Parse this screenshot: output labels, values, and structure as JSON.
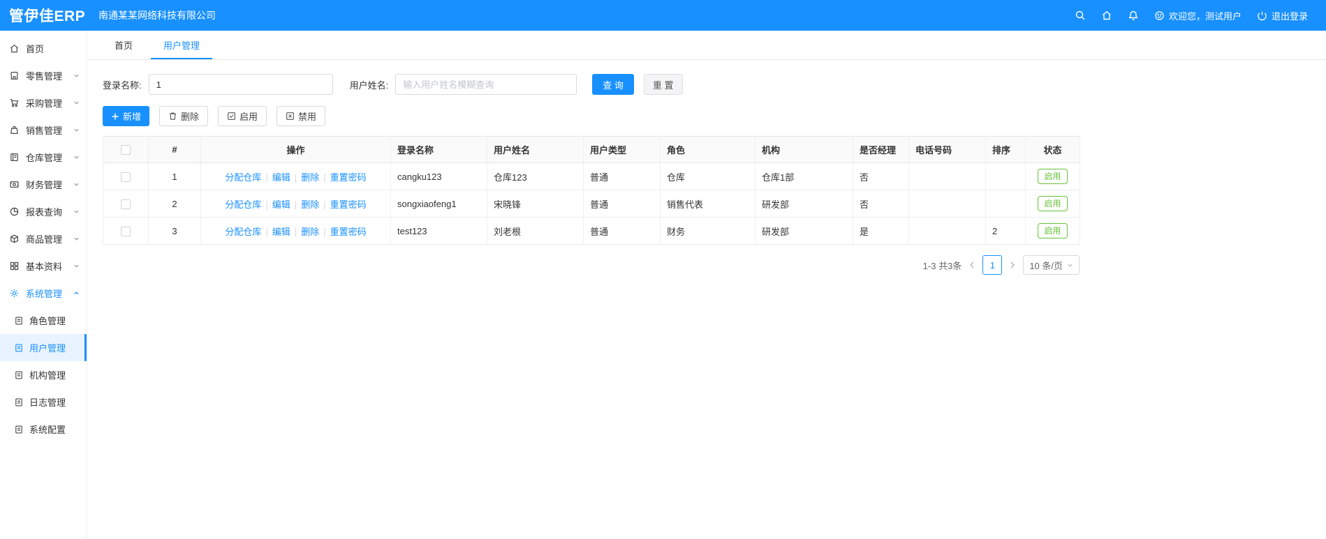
{
  "header": {
    "logo": "管伊佳ERP",
    "company": "南通某某网络科技有限公司",
    "welcome": "欢迎您，测试用户",
    "logout": "退出登录"
  },
  "sidebar": {
    "items": [
      {
        "label": "首页",
        "icon": "home-icon"
      },
      {
        "label": "零售管理",
        "icon": "retail-icon"
      },
      {
        "label": "采购管理",
        "icon": "purchase-icon"
      },
      {
        "label": "销售管理",
        "icon": "sales-icon"
      },
      {
        "label": "仓库管理",
        "icon": "warehouse-icon"
      },
      {
        "label": "财务管理",
        "icon": "finance-icon"
      },
      {
        "label": "报表查询",
        "icon": "report-icon"
      },
      {
        "label": "商品管理",
        "icon": "product-icon"
      },
      {
        "label": "基本资料",
        "icon": "basic-data-icon"
      },
      {
        "label": "系统管理",
        "icon": "gear-icon"
      }
    ],
    "system_children": [
      {
        "label": "角色管理"
      },
      {
        "label": "用户管理"
      },
      {
        "label": "机构管理"
      },
      {
        "label": "日志管理"
      },
      {
        "label": "系统配置"
      }
    ]
  },
  "tabs": [
    {
      "label": "首页"
    },
    {
      "label": "用户管理"
    }
  ],
  "search": {
    "login_label": "登录名称:",
    "login_value": "1",
    "username_label": "用户姓名:",
    "username_placeholder": "输入用户姓名模糊查询",
    "query_label": "查 询",
    "reset_label": "重 置"
  },
  "toolbar": {
    "add_label": "新增",
    "delete_label": "删除",
    "enable_label": "启用",
    "disable_label": "禁用"
  },
  "table": {
    "headers": [
      "#",
      "操作",
      "登录名称",
      "用户姓名",
      "用户类型",
      "角色",
      "机构",
      "是否经理",
      "电话号码",
      "排序",
      "状态"
    ],
    "actions": [
      "分配仓库",
      "编辑",
      "删除",
      "重置密码"
    ],
    "rows": [
      {
        "index": "1",
        "login": "cangku123",
        "name": "仓库123",
        "type": "普通",
        "role": "仓库",
        "org": "仓库1部",
        "manager": "否",
        "phone": "",
        "sort": "",
        "status": "启用"
      },
      {
        "index": "2",
        "login": "songxiaofeng1",
        "name": "宋晓锋",
        "type": "普通",
        "role": "销售代表",
        "org": "研发部",
        "manager": "否",
        "phone": "",
        "sort": "",
        "status": "启用"
      },
      {
        "index": "3",
        "login": "test123",
        "name": "刘老根",
        "type": "普通",
        "role": "财务",
        "org": "研发部",
        "manager": "是",
        "phone": "",
        "sort": "2",
        "status": "启用"
      }
    ]
  },
  "pagination": {
    "range": "1-3 共3条",
    "current": "1",
    "page_size": "10 条/页"
  },
  "colors": {
    "accent": "#1890ff",
    "status_green": "#67c23a"
  }
}
